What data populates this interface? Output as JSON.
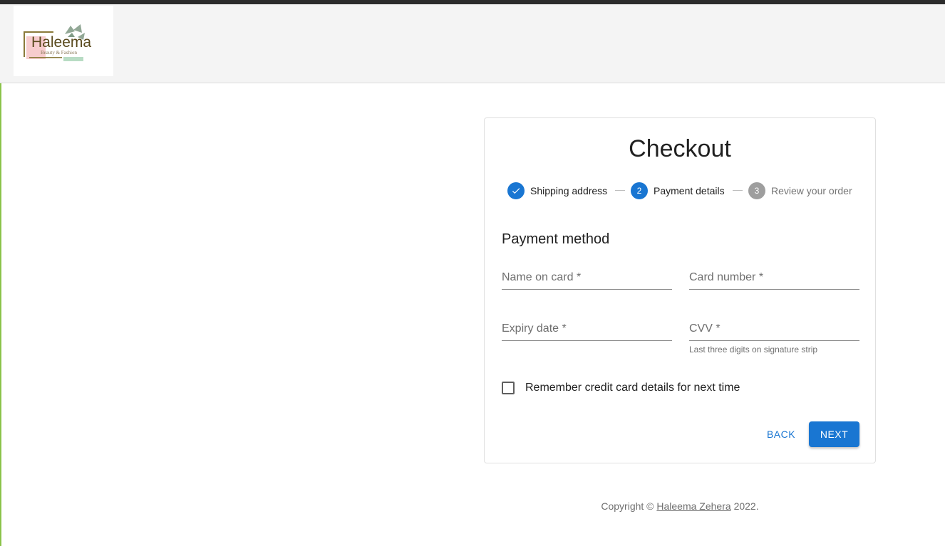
{
  "header": {
    "logo": {
      "brand": "Haleema",
      "tagline": "Beauty & Fashion"
    }
  },
  "checkout": {
    "title": "Checkout",
    "steps": [
      {
        "label": "Shipping address",
        "state": "completed",
        "icon": "check-icon"
      },
      {
        "label": "Payment details",
        "state": "active",
        "number": "2"
      },
      {
        "label": "Review your order",
        "state": "pending",
        "number": "3"
      }
    ],
    "section_title": "Payment method",
    "fields": {
      "name_on_card": {
        "label": "Name on card",
        "required_mark": "*",
        "value": ""
      },
      "card_number": {
        "label": "Card number",
        "required_mark": "*",
        "value": ""
      },
      "expiry_date": {
        "label": "Expiry date",
        "required_mark": "*",
        "value": ""
      },
      "cvv": {
        "label": "CVV",
        "required_mark": "*",
        "value": "",
        "helper": "Last three digits on signature strip"
      }
    },
    "remember_checkbox": {
      "label": "Remember credit card details for next time",
      "checked": false
    },
    "buttons": {
      "back": "BACK",
      "next": "NEXT"
    }
  },
  "footer": {
    "prefix": "Copyright ©",
    "link": "Haleema Zehera",
    "suffix": "2022."
  },
  "colors": {
    "primary": "#1976d2",
    "inactive_step": "#9e9e9e",
    "appbar_bg": "#f4f4f4"
  }
}
